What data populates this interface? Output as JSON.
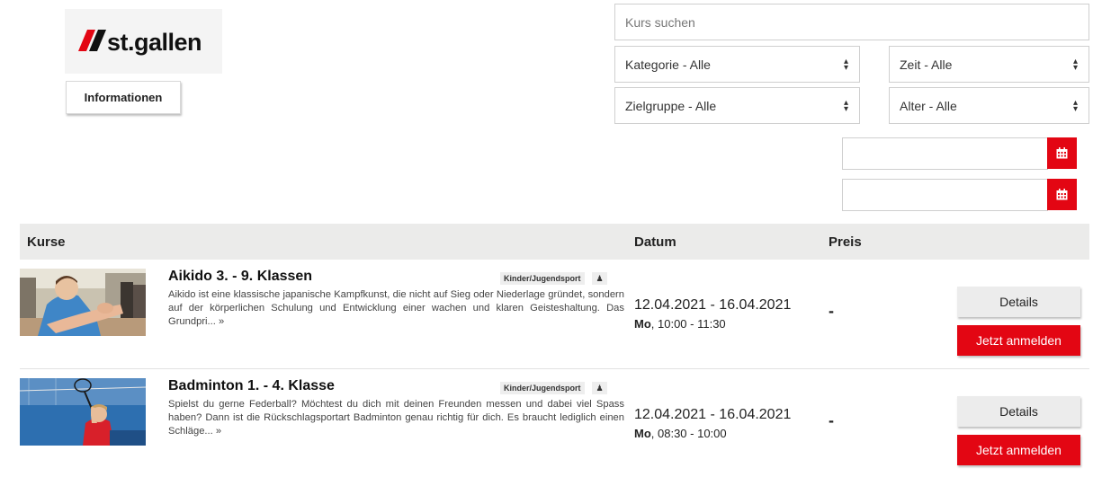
{
  "logo": {
    "text": "st.gallen",
    "colors": {
      "mark": "#e30613",
      "mark_secondary": "#111111"
    }
  },
  "info_button": {
    "label": "Informationen"
  },
  "filters": {
    "search_placeholder": "Kurs suchen",
    "category": {
      "selected": "Kategorie - Alle"
    },
    "time": {
      "selected": "Zeit - Alle"
    },
    "target_group": {
      "selected": "Zielgruppe - Alle"
    },
    "age": {
      "selected": "Alter - Alle"
    },
    "date_from": {
      "value": "",
      "icon": "calendar-icon"
    },
    "date_to": {
      "value": "",
      "icon": "calendar-icon"
    }
  },
  "table": {
    "headers": {
      "courses": "Kurse",
      "date": "Datum",
      "price": "Preis"
    },
    "rows": [
      {
        "title": "Aikido 3. - 9. Klassen",
        "badge": "Kinder/Jugendsport",
        "badge_icon": "person-icon",
        "description": "Aikido ist eine klassische japanische Kampfkunst, die nicht auf Sieg oder Niederlage gründet, sondern auf der körperlichen Schulung und Entwicklung einer wachen und klaren Geisteshaltung. Das Grundpri... »",
        "date_range": "12.04.2021 - 16.04.2021",
        "weekday": "Mo",
        "time": ", 10:00 - 11:30",
        "price": "-",
        "details_label": "Details",
        "signup_label": "Jetzt anmelden"
      },
      {
        "title": "Badminton 1. - 4. Klasse",
        "badge": "Kinder/Jugendsport",
        "badge_icon": "person-icon",
        "description": "Spielst du gerne Federball? Möchtest du dich mit deinen Freunden messen und dabei viel Spass haben? Dann ist die Rückschlagsportart Badminton genau richtig für dich. Es braucht lediglich einen Schläge... »",
        "date_range": "12.04.2021 - 16.04.2021",
        "weekday": "Mo",
        "time": ", 08:30 - 10:00",
        "price": "-",
        "details_label": "Details",
        "signup_label": "Jetzt anmelden"
      }
    ]
  },
  "colors": {
    "accent": "#e30613",
    "header_bg": "#ebebea",
    "button_bg": "#ececec"
  }
}
